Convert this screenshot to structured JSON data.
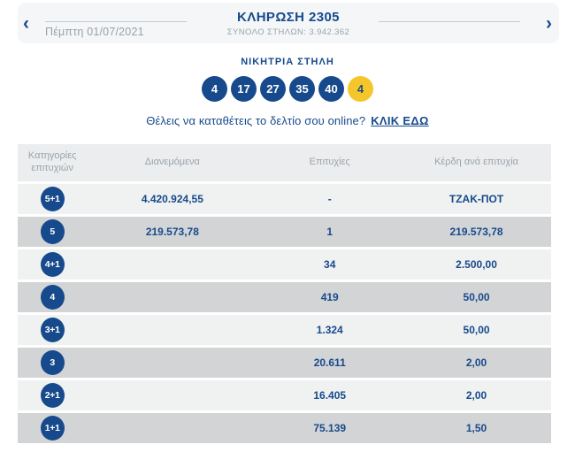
{
  "brand": {
    "blue": "#174a8c",
    "yellow": "#f4c62c",
    "row_light": "#f0f1f1",
    "row_dark": "#d3d4d5",
    "header_row_bg": "#ebedee",
    "strip_bg": "#f4f6f7"
  },
  "header": {
    "prev_arrow": "‹",
    "next_arrow": "›",
    "date": "Πέμπτη 01/07/2021",
    "title": "ΚΛΗΡΩΣΗ 2305",
    "subtitle": "ΣΥΝΟΛΟ ΣΤΗΛΩΝ: 3.942.362"
  },
  "winning": {
    "title": "ΝΙΚΗΤΡΙΑ ΣΤΗΛΗ",
    "numbers": [
      "4",
      "17",
      "27",
      "35",
      "40"
    ],
    "joker": "4",
    "prompt": "Θέλεις να καταθέτεις το δελτίο σου online?",
    "link": "ΚΛΙΚ ΕΔΩ"
  },
  "table": {
    "headers": [
      "Κατηγορίες επιτυχιών",
      "Διανεμόμενα",
      "Επιτυχίες",
      "Κέρδη ανά επιτυχία"
    ],
    "rows": [
      {
        "category": "5+1",
        "distributed": "4.420.924,55",
        "wins": "-",
        "prize": "ΤΖΑΚ-ΠΟΤ"
      },
      {
        "category": "5",
        "distributed": "219.573,78",
        "wins": "1",
        "prize": "219.573,78"
      },
      {
        "category": "4+1",
        "distributed": "",
        "wins": "34",
        "prize": "2.500,00"
      },
      {
        "category": "4",
        "distributed": "",
        "wins": "419",
        "prize": "50,00"
      },
      {
        "category": "3+1",
        "distributed": "",
        "wins": "1.324",
        "prize": "50,00"
      },
      {
        "category": "3",
        "distributed": "",
        "wins": "20.611",
        "prize": "2,00"
      },
      {
        "category": "2+1",
        "distributed": "",
        "wins": "16.405",
        "prize": "2,00"
      },
      {
        "category": "1+1",
        "distributed": "",
        "wins": "75.139",
        "prize": "1,50"
      }
    ]
  }
}
